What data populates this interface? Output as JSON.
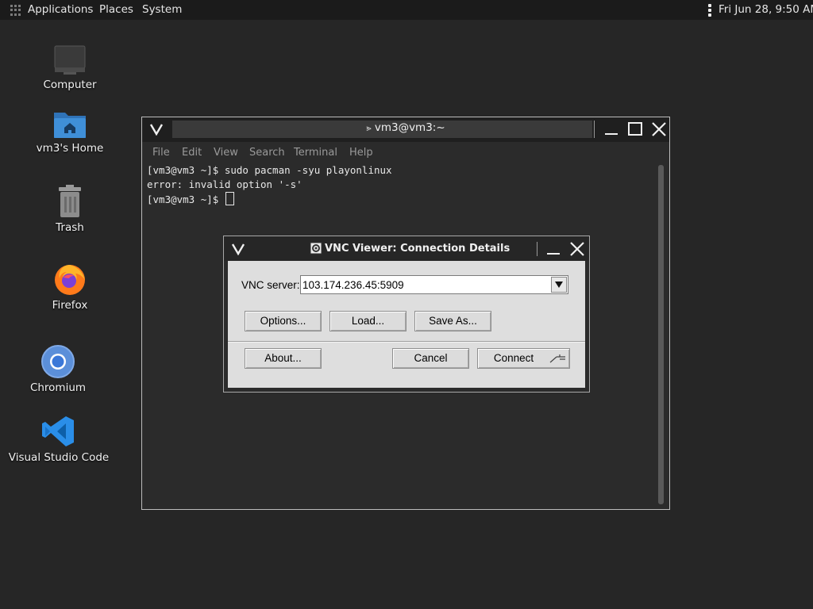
{
  "top_panel": {
    "applications": "Applications",
    "places": "Places",
    "system": "System",
    "clock": "Fri Jun 28,  9:50 AM"
  },
  "desktop": {
    "icons": [
      {
        "label": "Computer",
        "icon": "computer-icon"
      },
      {
        "label": "vm3's Home",
        "icon": "home-folder-icon"
      },
      {
        "label": "Trash",
        "icon": "trash-icon"
      },
      {
        "label": "Firefox",
        "icon": "firefox-icon"
      },
      {
        "label": "Chromium",
        "icon": "chromium-icon"
      },
      {
        "label": "Visual Studio Code",
        "icon": "vscode-icon"
      }
    ]
  },
  "terminal": {
    "title": "vm3@vm3:~",
    "menu": [
      "File",
      "Edit",
      "View",
      "Search",
      "Terminal",
      "Help"
    ],
    "lines": [
      "[vm3@vm3 ~]$ sudo pacman -syu playonlinux",
      "error: invalid option '-s'",
      "[vm3@vm3 ~]$ "
    ]
  },
  "vnc_dialog": {
    "title": "VNC Viewer: Connection Details",
    "server_label": "VNC server:",
    "server_value": "103.174.236.45:5909",
    "buttons": {
      "options": "Options...",
      "load": "Load...",
      "save_as": "Save As...",
      "about": "About...",
      "cancel": "Cancel",
      "connect": "Connect"
    }
  },
  "colors": {
    "desktop_bg": "#262626",
    "panel_bg": "#1b1b1b",
    "dialog_body": "#dedede",
    "folder_blue": "#3f8fd8",
    "vscode_blue": "#2a8ee8"
  }
}
